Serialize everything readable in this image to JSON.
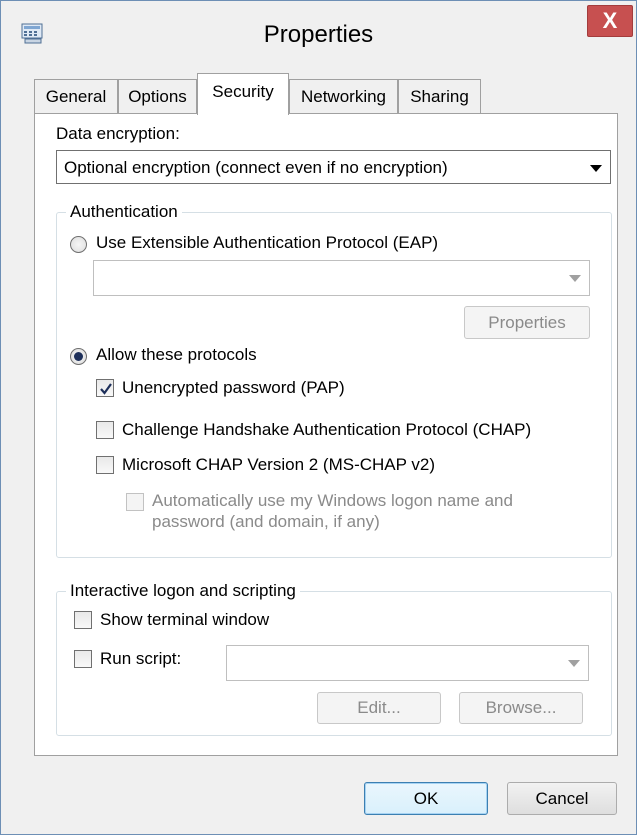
{
  "window": {
    "title": "Properties",
    "close_glyph": "X",
    "icon": "network-connection-icon"
  },
  "tabs": [
    {
      "label": "General",
      "active": false
    },
    {
      "label": "Options",
      "active": false
    },
    {
      "label": "Security",
      "active": true
    },
    {
      "label": "Networking",
      "active": false
    },
    {
      "label": "Sharing",
      "active": false
    }
  ],
  "security": {
    "data_encryption_label": "Data encryption:",
    "data_encryption_value": "Optional encryption (connect even if no encryption)",
    "authentication": {
      "group_label": "Authentication",
      "eap_option": {
        "label": "Use Extensible Authentication Protocol (EAP)",
        "selected": false
      },
      "eap_dropdown_value": "",
      "eap_properties_button": "Properties",
      "allow_protocols_option": {
        "label": "Allow these protocols",
        "selected": true
      },
      "protocols": [
        {
          "label": "Unencrypted password (PAP)",
          "checked": true
        },
        {
          "label": "Challenge Handshake Authentication Protocol (CHAP)",
          "checked": false
        },
        {
          "label": "Microsoft CHAP Version 2 (MS-CHAP v2)",
          "checked": false
        }
      ],
      "auto_logon": {
        "line1": "Automatically use my Windows logon name and",
        "line2": "password (and domain, if any)",
        "checked": false,
        "enabled": false
      }
    },
    "interactive": {
      "group_label": "Interactive logon and scripting",
      "show_terminal": {
        "label": "Show terminal window",
        "checked": false
      },
      "run_script": {
        "label": "Run script:",
        "checked": false
      },
      "script_value": "",
      "edit_button": "Edit...",
      "browse_button": "Browse..."
    }
  },
  "footer": {
    "ok_label": "OK",
    "cancel_label": "Cancel"
  }
}
